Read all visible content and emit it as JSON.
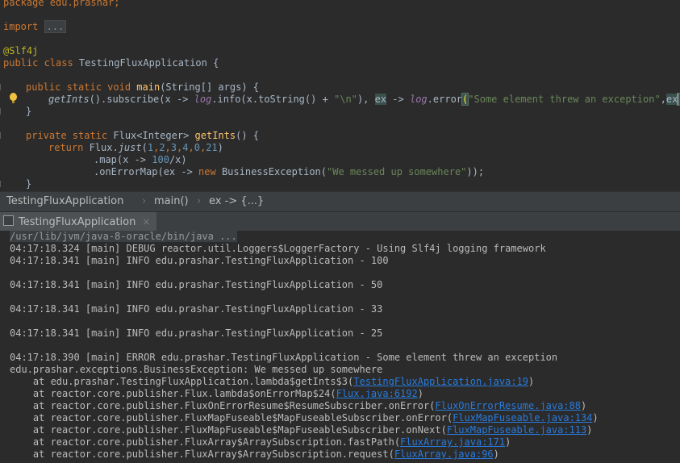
{
  "editor": {
    "lines": {
      "l0": "package edu.prashar;",
      "l1a": "import ",
      "l1b": "...",
      "l2": "@Slf4j",
      "l3a": "public class ",
      "l3b": "TestingFluxApplication {",
      "l4a": "public static void ",
      "l4b": "main",
      "l4c": "(String[] args) {",
      "l5a": "getInts",
      "l5b": "().subscribe(x -> ",
      "l5c": "log",
      "l5d": ".info(x.toString() + ",
      "l5e": "\"\\n\"",
      "l5f": "), ",
      "l5g": "ex",
      "l5h": " -> ",
      "l5i": "log",
      "l5j": ".error",
      "l5k": "(",
      "l5l": "\"Some element threw an exception\"",
      "l5m": ",",
      "l5n": "ex",
      "l5o": ")",
      "l5p": ");",
      "l6": "}",
      "l7a": "private static ",
      "l7b": "Flux<Integer> ",
      "l7c": "getInts",
      "l7d": "() {",
      "l8a": "return ",
      "l8b": "Flux.",
      "l8c": "just",
      "l8d": "(",
      "l8e": "1",
      "l8f": ",",
      "l8g": "2",
      "l8h": ",",
      "l8i": "3",
      "l8j": ",",
      "l8k": "4",
      "l8l": ",",
      "l8m": "0",
      "l8n": ",",
      "l8o": "21",
      "l8p": ")",
      "l9a": ".map(x -> ",
      "l9b": "100",
      "l9c": "/x)",
      "l10a": ".onErrorMap(ex -> ",
      "l10b": "new ",
      "l10c": "BusinessException(",
      "l10d": "\"We messed up somewhere\"",
      "l10e": "));",
      "l11": "}"
    }
  },
  "breadcrumb": {
    "class": "TestingFluxApplication",
    "method": "main()",
    "lambda": "ex -> {...}",
    "separator": "›"
  },
  "run_tab": {
    "label": "TestingFluxApplication",
    "close": "×"
  },
  "console": {
    "command": "/usr/lib/jvm/java-8-oracle/bin/java ...",
    "logs": [
      "04:17:18.324 [main] DEBUG reactor.util.Loggers$LoggerFactory - Using Slf4j logging framework",
      "04:17:18.341 [main] INFO edu.prashar.TestingFluxApplication - 100",
      "04:17:18.341 [main] INFO edu.prashar.TestingFluxApplication - 50",
      "04:17:18.341 [main] INFO edu.prashar.TestingFluxApplication - 33",
      "04:17:18.341 [main] INFO edu.prashar.TestingFluxApplication - 25",
      "04:17:18.390 [main] ERROR edu.prashar.TestingFluxApplication - Some element threw an exception",
      "edu.prashar.exceptions.BusinessException: We messed up somewhere"
    ],
    "stack": [
      {
        "prefix": "    at edu.prashar.TestingFluxApplication.lambda$getInts$3(",
        "link": "TestingFluxApplication.java:19",
        "suffix": ")"
      },
      {
        "prefix": "    at reactor.core.publisher.Flux.lambda$onErrorMap$24(",
        "link": "Flux.java:6192",
        "suffix": ")"
      },
      {
        "prefix": "    at reactor.core.publisher.FluxOnErrorResume$ResumeSubscriber.onError(",
        "link": "FluxOnErrorResume.java:88",
        "suffix": ")"
      },
      {
        "prefix": "    at reactor.core.publisher.FluxMapFuseable$MapFuseableSubscriber.onError(",
        "link": "FluxMapFuseable.java:134",
        "suffix": ")"
      },
      {
        "prefix": "    at reactor.core.publisher.FluxMapFuseable$MapFuseableSubscriber.onNext(",
        "link": "FluxMapFuseable.java:113",
        "suffix": ")"
      },
      {
        "prefix": "    at reactor.core.publisher.FluxArray$ArraySubscription.fastPath(",
        "link": "FluxArray.java:171",
        "suffix": ")"
      },
      {
        "prefix": "    at reactor.core.publisher.FluxArray$ArraySubscription.request(",
        "link": "FluxArray.java:96",
        "suffix": ")"
      }
    ]
  },
  "colors": {
    "background": "#2b2b2b",
    "keyword": "#cc7832",
    "string": "#6a8759",
    "number": "#6897bb",
    "link": "#287bde"
  },
  "icons": {
    "intention": "lightbulb-icon",
    "tab": "console-icon"
  }
}
